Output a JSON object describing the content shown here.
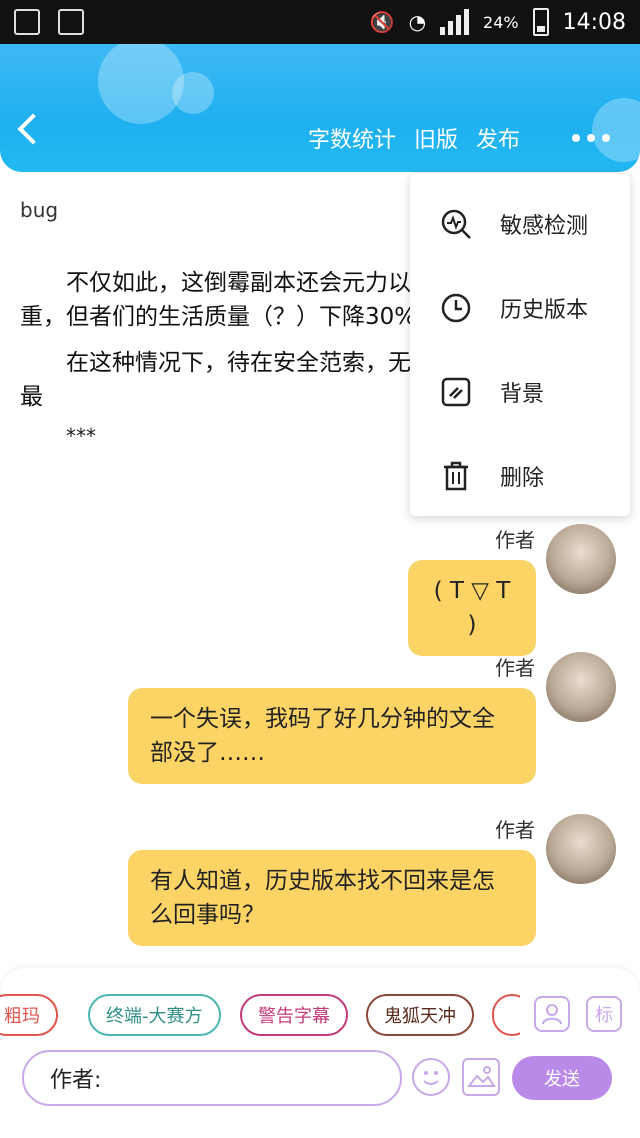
{
  "status_bar": {
    "battery": "24%",
    "time": "14:08"
  },
  "header": {
    "nav": [
      "字数统计",
      "旧版",
      "发布"
    ]
  },
  "document": {
    "tag": "bug",
    "paragraphs": [
      "不仅如此，这倒霉副本还会元力以及灵魂，并不很严重，但者们的生活质量（？）下降30%",
      "在这种情况下，待在安全范索，无疑是最稳妥也是危险最"
    ],
    "separator": "***"
  },
  "menu": {
    "items": [
      "敏感检测",
      "历史版本",
      "背景",
      "删除"
    ]
  },
  "chat": {
    "author_label": "作者",
    "messages": [
      "( T ▽ T )",
      "一个失误，我码了好几分钟的文全部没了……",
      "有人知道，历史版本找不回来是怎么回事吗？"
    ]
  },
  "composer": {
    "chips": [
      "粗玛",
      "终端-大赛方",
      "警告字幕",
      "鬼狐天冲"
    ],
    "chip_colors": [
      "#e0554c",
      "#4bb8b0",
      "#c23b7a",
      "#8a4a3a"
    ],
    "side_button_label": "标",
    "input_value": "作者:",
    "send_label": "发送"
  }
}
